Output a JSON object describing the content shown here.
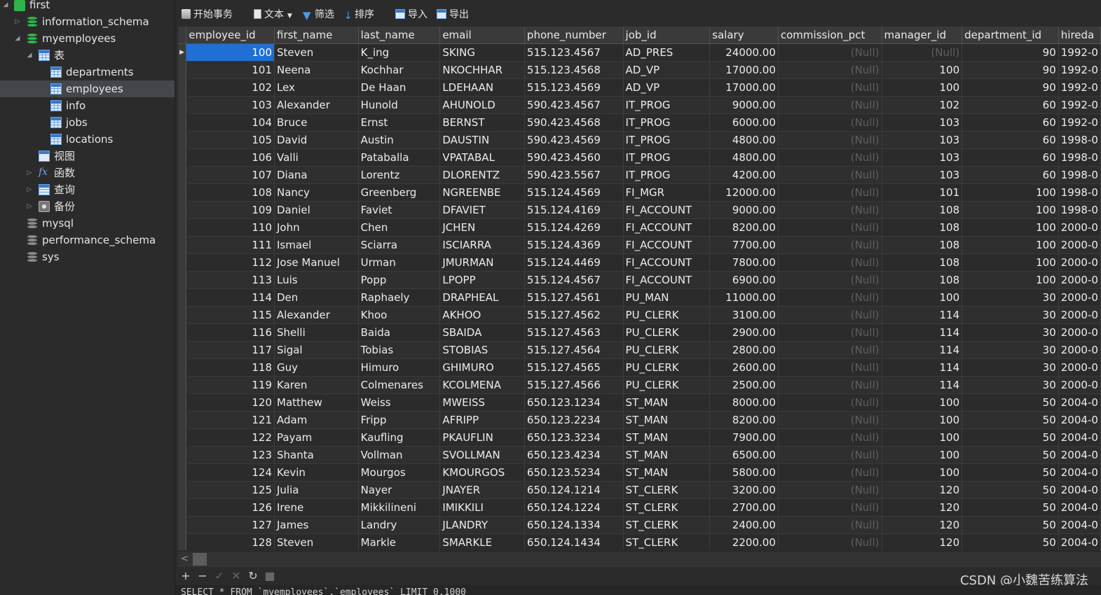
{
  "sidebar": {
    "connection": "first",
    "databases": [
      {
        "name": "information_schema"
      },
      {
        "name": "myemployees"
      },
      {
        "name": "mysql"
      },
      {
        "name": "performance_schema"
      },
      {
        "name": "sys"
      }
    ],
    "tables_folder": "表",
    "tables": [
      "departments",
      "employees",
      "info",
      "jobs",
      "locations"
    ],
    "selected_table": "employees",
    "other_folders": [
      "视图",
      "函数",
      "查询",
      "备份"
    ]
  },
  "toolbar": {
    "begin_transaction": "开始事务",
    "text": "文本",
    "filter": "筛选",
    "sort": "排序",
    "import": "导入",
    "export": "导出"
  },
  "grid": {
    "columns": [
      "employee_id",
      "first_name",
      "last_name",
      "email",
      "phone_number",
      "job_id",
      "salary",
      "commission_pct",
      "manager_id",
      "department_id",
      "hireda"
    ],
    "rows": [
      [
        "100",
        "Steven",
        "K_ing",
        "SKING",
        "515.123.4567",
        "AD_PRES",
        "24000.00",
        "(Null)",
        "(Null)",
        "90",
        "1992-0"
      ],
      [
        "101",
        "Neena",
        "Kochhar",
        "NKOCHHAR",
        "515.123.4568",
        "AD_VP",
        "17000.00",
        "(Null)",
        "100",
        "90",
        "1992-0"
      ],
      [
        "102",
        "Lex",
        "De Haan",
        "LDEHAAN",
        "515.123.4569",
        "AD_VP",
        "17000.00",
        "(Null)",
        "100",
        "90",
        "1992-0"
      ],
      [
        "103",
        "Alexander",
        "Hunold",
        "AHUNOLD",
        "590.423.4567",
        "IT_PROG",
        "9000.00",
        "(Null)",
        "102",
        "60",
        "1992-0"
      ],
      [
        "104",
        "Bruce",
        "Ernst",
        "BERNST",
        "590.423.4568",
        "IT_PROG",
        "6000.00",
        "(Null)",
        "103",
        "60",
        "1992-0"
      ],
      [
        "105",
        "David",
        "Austin",
        "DAUSTIN",
        "590.423.4569",
        "IT_PROG",
        "4800.00",
        "(Null)",
        "103",
        "60",
        "1998-0"
      ],
      [
        "106",
        "Valli",
        "Pataballa",
        "VPATABAL",
        "590.423.4560",
        "IT_PROG",
        "4800.00",
        "(Null)",
        "103",
        "60",
        "1998-0"
      ],
      [
        "107",
        "Diana",
        "Lorentz",
        "DLORENTZ",
        "590.423.5567",
        "IT_PROG",
        "4200.00",
        "(Null)",
        "103",
        "60",
        "1998-0"
      ],
      [
        "108",
        "Nancy",
        "Greenberg",
        "NGREENBE",
        "515.124.4569",
        "FI_MGR",
        "12000.00",
        "(Null)",
        "101",
        "100",
        "1998-0"
      ],
      [
        "109",
        "Daniel",
        "Faviet",
        "DFAVIET",
        "515.124.4169",
        "FI_ACCOUNT",
        "9000.00",
        "(Null)",
        "108",
        "100",
        "1998-0"
      ],
      [
        "110",
        "John",
        "Chen",
        "JCHEN",
        "515.124.4269",
        "FI_ACCOUNT",
        "8200.00",
        "(Null)",
        "108",
        "100",
        "2000-0"
      ],
      [
        "111",
        "Ismael",
        "Sciarra",
        "ISCIARRA",
        "515.124.4369",
        "FI_ACCOUNT",
        "7700.00",
        "(Null)",
        "108",
        "100",
        "2000-0"
      ],
      [
        "112",
        "Jose Manuel",
        "Urman",
        "JMURMAN",
        "515.124.4469",
        "FI_ACCOUNT",
        "7800.00",
        "(Null)",
        "108",
        "100",
        "2000-0"
      ],
      [
        "113",
        "Luis",
        "Popp",
        "LPOPP",
        "515.124.4567",
        "FI_ACCOUNT",
        "6900.00",
        "(Null)",
        "108",
        "100",
        "2000-0"
      ],
      [
        "114",
        "Den",
        "Raphaely",
        "DRAPHEAL",
        "515.127.4561",
        "PU_MAN",
        "11000.00",
        "(Null)",
        "100",
        "30",
        "2000-0"
      ],
      [
        "115",
        "Alexander",
        "Khoo",
        "AKHOO",
        "515.127.4562",
        "PU_CLERK",
        "3100.00",
        "(Null)",
        "114",
        "30",
        "2000-0"
      ],
      [
        "116",
        "Shelli",
        "Baida",
        "SBAIDA",
        "515.127.4563",
        "PU_CLERK",
        "2900.00",
        "(Null)",
        "114",
        "30",
        "2000-0"
      ],
      [
        "117",
        "Sigal",
        "Tobias",
        "STOBIAS",
        "515.127.4564",
        "PU_CLERK",
        "2800.00",
        "(Null)",
        "114",
        "30",
        "2000-0"
      ],
      [
        "118",
        "Guy",
        "Himuro",
        "GHIMURO",
        "515.127.4565",
        "PU_CLERK",
        "2600.00",
        "(Null)",
        "114",
        "30",
        "2000-0"
      ],
      [
        "119",
        "Karen",
        "Colmenares",
        "KCOLMENA",
        "515.127.4566",
        "PU_CLERK",
        "2500.00",
        "(Null)",
        "114",
        "30",
        "2000-0"
      ],
      [
        "120",
        "Matthew",
        "Weiss",
        "MWEISS",
        "650.123.1234",
        "ST_MAN",
        "8000.00",
        "(Null)",
        "100",
        "50",
        "2004-0"
      ],
      [
        "121",
        "Adam",
        "Fripp",
        "AFRIPP",
        "650.123.2234",
        "ST_MAN",
        "8200.00",
        "(Null)",
        "100",
        "50",
        "2004-0"
      ],
      [
        "122",
        "Payam",
        "Kaufling",
        "PKAUFLIN",
        "650.123.3234",
        "ST_MAN",
        "7900.00",
        "(Null)",
        "100",
        "50",
        "2004-0"
      ],
      [
        "123",
        "Shanta",
        "Vollman",
        "SVOLLMAN",
        "650.123.4234",
        "ST_MAN",
        "6500.00",
        "(Null)",
        "100",
        "50",
        "2004-0"
      ],
      [
        "124",
        "Kevin",
        "Mourgos",
        "KMOURGOS",
        "650.123.5234",
        "ST_MAN",
        "5800.00",
        "(Null)",
        "100",
        "50",
        "2004-0"
      ],
      [
        "125",
        "Julia",
        "Nayer",
        "JNAYER",
        "650.124.1214",
        "ST_CLERK",
        "3200.00",
        "(Null)",
        "120",
        "50",
        "2004-0"
      ],
      [
        "126",
        "Irene",
        "Mikkilineni",
        "IMIKKILI",
        "650.124.1224",
        "ST_CLERK",
        "2700.00",
        "(Null)",
        "120",
        "50",
        "2004-0"
      ],
      [
        "127",
        "James",
        "Landry",
        "JLANDRY",
        "650.124.1334",
        "ST_CLERK",
        "2400.00",
        "(Null)",
        "120",
        "50",
        "2004-0"
      ],
      [
        "128",
        "Steven",
        "Markle",
        "SMARKLE",
        "650.124.1434",
        "ST_CLERK",
        "2200.00",
        "(Null)",
        "120",
        "50",
        "2004-0"
      ]
    ]
  },
  "bottom": {
    "watermark": "CSDN @小魏苦练算法",
    "sql": "SELECT * FROM `myemployees`.`employees` LIMIT 0,1000"
  },
  "colors": {
    "selection": "#1f6fd4",
    "db_icon": "#2fb34a",
    "db_icon_inactive": "#8a8a8a",
    "table_icon": "#3b78c8"
  }
}
